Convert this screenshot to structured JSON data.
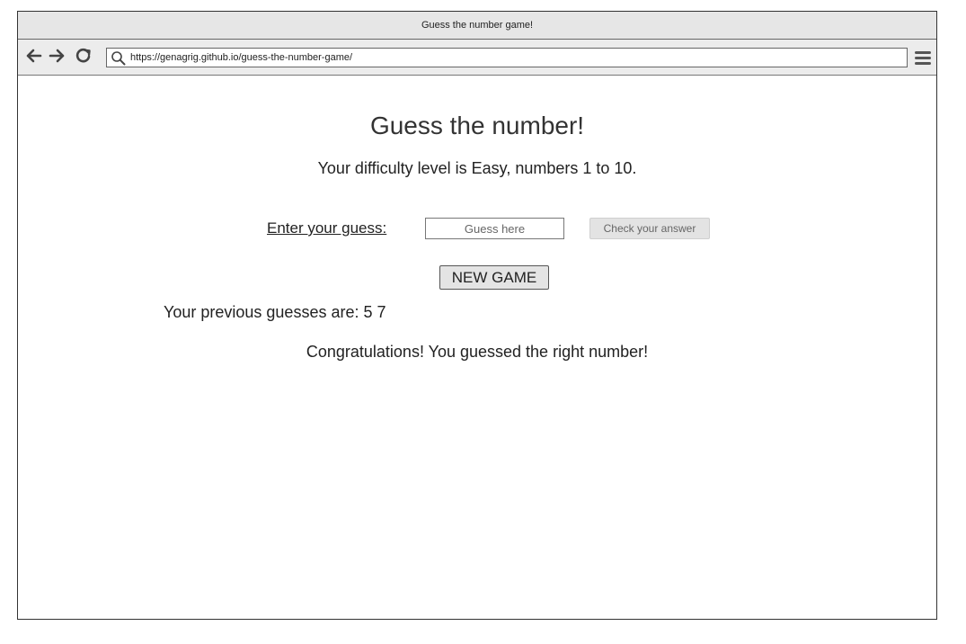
{
  "window": {
    "title": "Guess the number game!"
  },
  "browser": {
    "url": "https://genagrig.github.io/guess-the-number-game/"
  },
  "page": {
    "heading": "Guess the number!",
    "difficulty_text": "Your difficulty level is Easy, numbers 1 to 10.",
    "guess_label": "Enter your guess:",
    "guess_placeholder": "Guess here",
    "check_button": "Check your answer",
    "new_game_button": "NEW GAME",
    "previous_guesses": "Your previous guesses are: 5 7",
    "result_message": "Congratulations! You guessed the right number!"
  },
  "icons": [
    "back-arrow-icon",
    "forward-arrow-icon",
    "reload-icon",
    "search-icon",
    "hamburger-menu-icon"
  ]
}
